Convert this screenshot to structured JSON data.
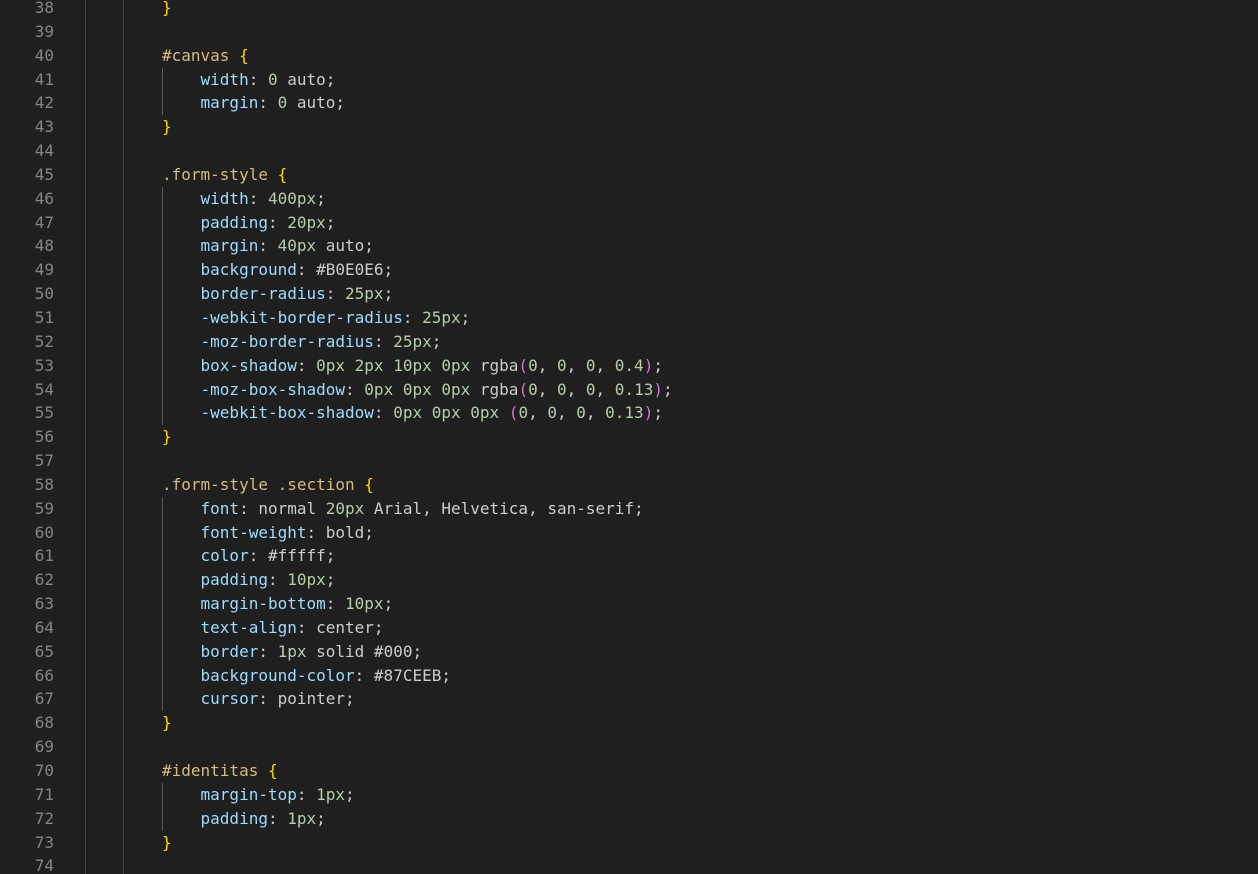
{
  "editor": {
    "theme_colors": {
      "background": "#1f1f1f",
      "line_number": "#858585",
      "selector": "#d7ba7d",
      "brace": "#ffd700",
      "paren": "#da70d6",
      "property": "#9cdcfe",
      "number": "#b5cea8",
      "value": "#cccccc"
    },
    "lines": [
      {
        "n": "38",
        "tokens": [
          [
            "brace",
            "}"
          ]
        ]
      },
      {
        "n": "39",
        "tokens": []
      },
      {
        "n": "40",
        "tokens": [
          [
            "sel",
            "#canvas "
          ],
          [
            "brace",
            "{"
          ]
        ]
      },
      {
        "n": "41",
        "tokens": [
          [
            "ind",
            "    "
          ],
          [
            "prop",
            "width"
          ],
          [
            "pun",
            ": "
          ],
          [
            "num",
            "0"
          ],
          [
            "val",
            " auto;"
          ]
        ]
      },
      {
        "n": "42",
        "tokens": [
          [
            "ind",
            "    "
          ],
          [
            "prop",
            "margin"
          ],
          [
            "pun",
            ": "
          ],
          [
            "num",
            "0"
          ],
          [
            "val",
            " auto;"
          ]
        ]
      },
      {
        "n": "43",
        "tokens": [
          [
            "brace",
            "}"
          ]
        ]
      },
      {
        "n": "44",
        "tokens": []
      },
      {
        "n": "45",
        "tokens": [
          [
            "sel",
            ".form-style "
          ],
          [
            "brace",
            "{"
          ]
        ]
      },
      {
        "n": "46",
        "tokens": [
          [
            "ind",
            "    "
          ],
          [
            "prop",
            "width"
          ],
          [
            "pun",
            ": "
          ],
          [
            "num",
            "400px"
          ],
          [
            "pun",
            ";"
          ]
        ]
      },
      {
        "n": "47",
        "tokens": [
          [
            "ind",
            "    "
          ],
          [
            "prop",
            "padding"
          ],
          [
            "pun",
            ": "
          ],
          [
            "num",
            "20px"
          ],
          [
            "pun",
            ";"
          ]
        ]
      },
      {
        "n": "48",
        "tokens": [
          [
            "ind",
            "    "
          ],
          [
            "prop",
            "margin"
          ],
          [
            "pun",
            ": "
          ],
          [
            "num",
            "40px"
          ],
          [
            "val",
            " auto;"
          ]
        ]
      },
      {
        "n": "49",
        "tokens": [
          [
            "ind",
            "    "
          ],
          [
            "prop",
            "background"
          ],
          [
            "pun",
            ": "
          ],
          [
            "val",
            "#B0E0E6;"
          ]
        ]
      },
      {
        "n": "50",
        "tokens": [
          [
            "ind",
            "    "
          ],
          [
            "prop",
            "border-radius"
          ],
          [
            "pun",
            ": "
          ],
          [
            "num",
            "25px"
          ],
          [
            "pun",
            ";"
          ]
        ]
      },
      {
        "n": "51",
        "tokens": [
          [
            "ind",
            "    "
          ],
          [
            "prop",
            "-webkit-border-radius"
          ],
          [
            "pun",
            ": "
          ],
          [
            "num",
            "25px"
          ],
          [
            "pun",
            ";"
          ]
        ]
      },
      {
        "n": "52",
        "tokens": [
          [
            "ind",
            "    "
          ],
          [
            "prop",
            "-moz-border-radius"
          ],
          [
            "pun",
            ": "
          ],
          [
            "num",
            "25px"
          ],
          [
            "pun",
            ";"
          ]
        ]
      },
      {
        "n": "53",
        "tokens": [
          [
            "ind",
            "    "
          ],
          [
            "prop",
            "box-shadow"
          ],
          [
            "pun",
            ": "
          ],
          [
            "num",
            "0px 2px 10px 0px"
          ],
          [
            "val",
            " rgba"
          ],
          [
            "paren",
            "("
          ],
          [
            "num",
            "0"
          ],
          [
            "pun",
            ", "
          ],
          [
            "num",
            "0"
          ],
          [
            "pun",
            ", "
          ],
          [
            "num",
            "0"
          ],
          [
            "pun",
            ", "
          ],
          [
            "num",
            "0.4"
          ],
          [
            "paren",
            ")"
          ],
          [
            "pun",
            ";"
          ]
        ]
      },
      {
        "n": "54",
        "tokens": [
          [
            "ind",
            "    "
          ],
          [
            "prop",
            "-moz-box-shadow"
          ],
          [
            "pun",
            ": "
          ],
          [
            "num",
            "0px 0px 0px"
          ],
          [
            "val",
            " rgba"
          ],
          [
            "paren",
            "("
          ],
          [
            "num",
            "0"
          ],
          [
            "pun",
            ", "
          ],
          [
            "num",
            "0"
          ],
          [
            "pun",
            ", "
          ],
          [
            "num",
            "0"
          ],
          [
            "pun",
            ", "
          ],
          [
            "num",
            "0.13"
          ],
          [
            "paren",
            ")"
          ],
          [
            "pun",
            ";"
          ]
        ]
      },
      {
        "n": "55",
        "tokens": [
          [
            "ind",
            "    "
          ],
          [
            "prop",
            "-webkit-box-shadow"
          ],
          [
            "pun",
            ": "
          ],
          [
            "num",
            "0px 0px 0px"
          ],
          [
            "pun",
            " "
          ],
          [
            "paren",
            "("
          ],
          [
            "num",
            "0"
          ],
          [
            "pun",
            ", "
          ],
          [
            "num",
            "0"
          ],
          [
            "pun",
            ", "
          ],
          [
            "num",
            "0"
          ],
          [
            "pun",
            ", "
          ],
          [
            "num",
            "0.13"
          ],
          [
            "paren",
            ")"
          ],
          [
            "pun",
            ";"
          ]
        ]
      },
      {
        "n": "56",
        "tokens": [
          [
            "brace",
            "}"
          ]
        ]
      },
      {
        "n": "57",
        "tokens": []
      },
      {
        "n": "58",
        "tokens": [
          [
            "sel",
            ".form-style .section "
          ],
          [
            "brace",
            "{"
          ]
        ]
      },
      {
        "n": "59",
        "tokens": [
          [
            "ind",
            "    "
          ],
          [
            "prop",
            "font"
          ],
          [
            "pun",
            ": "
          ],
          [
            "val",
            "normal "
          ],
          [
            "num",
            "20px"
          ],
          [
            "val",
            " Arial, Helvetica, san-serif;"
          ]
        ]
      },
      {
        "n": "60",
        "tokens": [
          [
            "ind",
            "    "
          ],
          [
            "prop",
            "font-weight"
          ],
          [
            "pun",
            ": "
          ],
          [
            "val",
            "bold;"
          ]
        ]
      },
      {
        "n": "61",
        "tokens": [
          [
            "ind",
            "    "
          ],
          [
            "prop",
            "color"
          ],
          [
            "pun",
            ": "
          ],
          [
            "val",
            "#fffff;"
          ]
        ]
      },
      {
        "n": "62",
        "tokens": [
          [
            "ind",
            "    "
          ],
          [
            "prop",
            "padding"
          ],
          [
            "pun",
            ": "
          ],
          [
            "num",
            "10px"
          ],
          [
            "pun",
            ";"
          ]
        ]
      },
      {
        "n": "63",
        "tokens": [
          [
            "ind",
            "    "
          ],
          [
            "prop",
            "margin-bottom"
          ],
          [
            "pun",
            ": "
          ],
          [
            "num",
            "10px"
          ],
          [
            "pun",
            ";"
          ]
        ]
      },
      {
        "n": "64",
        "tokens": [
          [
            "ind",
            "    "
          ],
          [
            "prop",
            "text-align"
          ],
          [
            "pun",
            ": "
          ],
          [
            "val",
            "center;"
          ]
        ]
      },
      {
        "n": "65",
        "tokens": [
          [
            "ind",
            "    "
          ],
          [
            "prop",
            "border"
          ],
          [
            "pun",
            ": "
          ],
          [
            "num",
            "1px"
          ],
          [
            "val",
            " solid #000;"
          ]
        ]
      },
      {
        "n": "66",
        "tokens": [
          [
            "ind",
            "    "
          ],
          [
            "prop",
            "background-color"
          ],
          [
            "pun",
            ": "
          ],
          [
            "val",
            "#87CEEB;"
          ]
        ]
      },
      {
        "n": "67",
        "tokens": [
          [
            "ind",
            "    "
          ],
          [
            "prop",
            "cursor"
          ],
          [
            "pun",
            ": "
          ],
          [
            "val",
            "pointer;"
          ]
        ]
      },
      {
        "n": "68",
        "tokens": [
          [
            "brace",
            "}"
          ]
        ]
      },
      {
        "n": "69",
        "tokens": []
      },
      {
        "n": "70",
        "tokens": [
          [
            "sel",
            "#identitas "
          ],
          [
            "brace",
            "{"
          ]
        ]
      },
      {
        "n": "71",
        "tokens": [
          [
            "ind",
            "    "
          ],
          [
            "prop",
            "margin-top"
          ],
          [
            "pun",
            ": "
          ],
          [
            "num",
            "1px"
          ],
          [
            "pun",
            ";"
          ]
        ]
      },
      {
        "n": "72",
        "tokens": [
          [
            "ind",
            "    "
          ],
          [
            "prop",
            "padding"
          ],
          [
            "pun",
            ": "
          ],
          [
            "num",
            "1px"
          ],
          [
            "pun",
            ";"
          ]
        ]
      },
      {
        "n": "73",
        "tokens": [
          [
            "brace",
            "}"
          ]
        ]
      },
      {
        "n": "74",
        "tokens": []
      }
    ]
  }
}
